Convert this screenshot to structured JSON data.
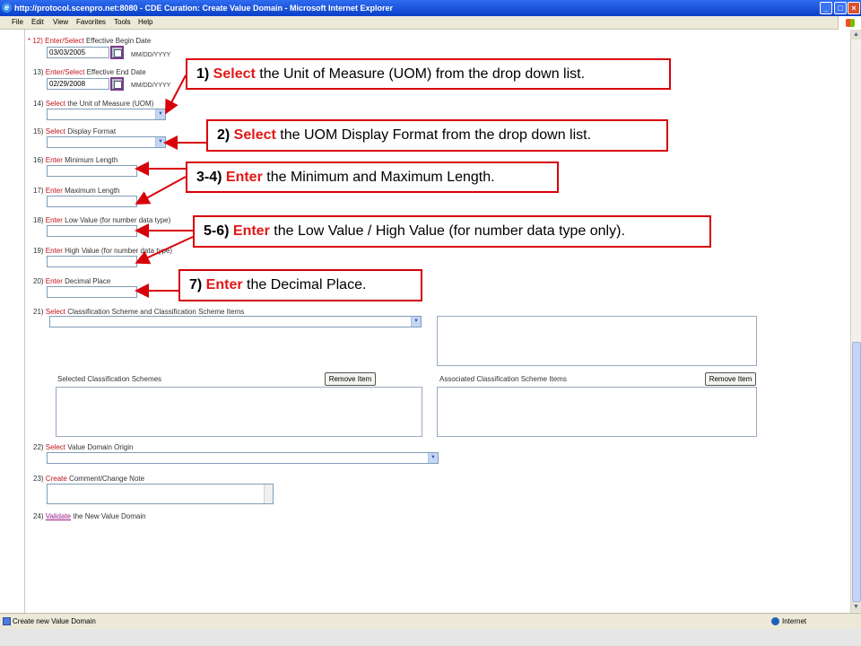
{
  "window": {
    "title": "http://protocol.scenpro.net:8080 - CDE Curation: Create Value Domain - Microsoft Internet Explorer",
    "minimize": "_",
    "maximize": "□",
    "close": "×"
  },
  "menu": [
    "File",
    "Edit",
    "View",
    "Favorites",
    "Tools",
    "Help"
  ],
  "fields": {
    "f12": {
      "num": "* 12)",
      "action": "Enter/Select",
      "text": " Effective Begin Date",
      "value": "03/03/2005",
      "format": "MM/DD/YYYY"
    },
    "f13": {
      "num": "13)",
      "action": "Enter/Select",
      "text": " Effective End Date",
      "value": "02/29/2008",
      "format": "MM/DD/YYYY"
    },
    "f14": {
      "num": "14)",
      "action": "Select",
      "text": " the Unit of Measure (UOM)"
    },
    "f15": {
      "num": "15)",
      "action": "Select",
      "text": " Display Format"
    },
    "f16": {
      "num": "16)",
      "action": "Enter",
      "text": " Minimum Length"
    },
    "f17": {
      "num": "17)",
      "action": "Enter",
      "text": " Maximum Length"
    },
    "f18": {
      "num": "18)",
      "action": "Enter",
      "text": " Low Value (for number data type)"
    },
    "f19": {
      "num": "19)",
      "action": "Enter",
      "text": " High Value (for number data type)"
    },
    "f20": {
      "num": "20)",
      "action": "Enter",
      "text": " Decimal Place"
    },
    "f21": {
      "num": "21)",
      "action": "Select",
      "text": " Classification Scheme and Classification Scheme Items"
    },
    "f22": {
      "num": "22)",
      "action": "Select",
      "text": " Value Domain Origin"
    },
    "f23": {
      "num": "23)",
      "action": "Create",
      "text": " Comment/Change Note"
    },
    "f24": {
      "num": "24)",
      "action": "Validate",
      "text": " the New Value Domain"
    }
  },
  "classification": {
    "selected_label": "Selected Classification Schemes",
    "associated_label": "Associated Classification Scheme Items",
    "remove_label": "Remove Item"
  },
  "callouts": {
    "c1": {
      "num": "1) ",
      "kw": "Select",
      "rest": " the Unit of Measure (UOM) from the drop down list."
    },
    "c2": {
      "num": "2) ",
      "kw": "Select",
      "rest": " the UOM Display Format from the drop down list."
    },
    "c3": {
      "num": "3-4) ",
      "kw": "Enter",
      "rest": " the Minimum and Maximum Length."
    },
    "c4": {
      "num": "5-6) ",
      "kw": "Enter",
      "rest": " the Low Value / High Value (for number data type only)."
    },
    "c5": {
      "num": "7) ",
      "kw": "Enter",
      "rest": " the Decimal Place."
    }
  },
  "status": {
    "text": "Create new Value Domain",
    "zone": "Internet"
  },
  "colors": {
    "accent_red": "#d8000a",
    "title_blue": "#0a3fc8",
    "link_purple": "#9a1a8a"
  }
}
